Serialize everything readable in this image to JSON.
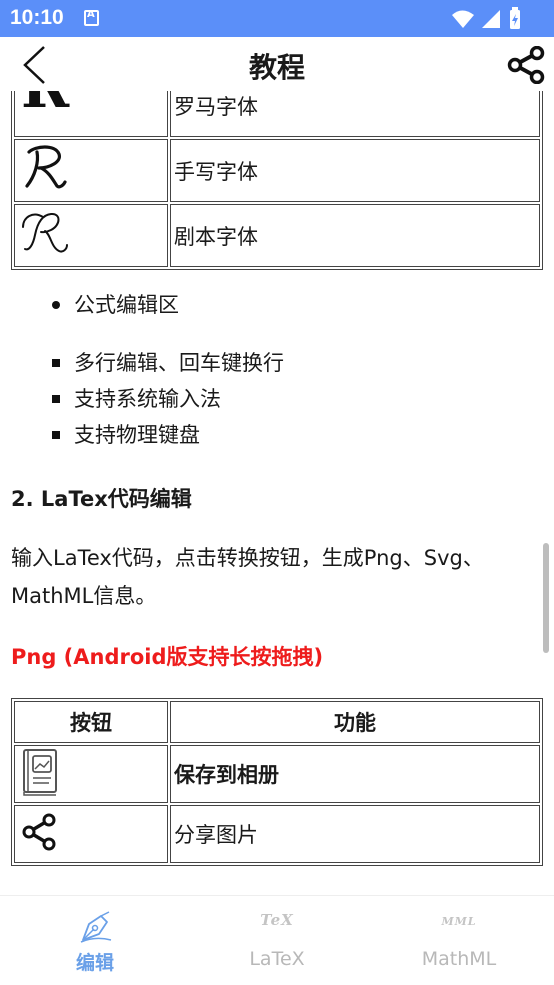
{
  "status_bar": {
    "time": "10:10"
  },
  "header": {
    "title": "教程"
  },
  "font_table": {
    "rows": [
      {
        "label": "罗马字体"
      },
      {
        "label": "手写字体"
      },
      {
        "label": "剧本字体"
      }
    ]
  },
  "bullets_circle": [
    "公式编辑区"
  ],
  "bullets_square": [
    "多行编辑、回车键换行",
    "支持系统输入法",
    "支持物理键盘"
  ],
  "section_heading": "2. LaTex代码编辑",
  "paragraph": "输入LaTex代码，点击转换按钮，生成Png、Svg、MathML信息。",
  "red_heading": "Png (Android版支持长按拖拽)",
  "button_table": {
    "headers": [
      "按钮",
      "功能"
    ],
    "rows": [
      {
        "icon": "photo-album-icon",
        "label": "保存到相册"
      },
      {
        "icon": "share-icon",
        "label": "分享图片"
      }
    ]
  },
  "bottom_nav": {
    "tabs": [
      {
        "label": "编辑",
        "icon_text": "",
        "active": true
      },
      {
        "label": "LaTeX",
        "icon_text": "TeX",
        "active": false
      },
      {
        "label": "MathML",
        "icon_text": "MML",
        "active": false
      }
    ]
  },
  "colors": {
    "status_bar": "#5b8ff9",
    "accent": "#6aa0e8",
    "red_heading": "#ee1c1c",
    "inactive": "#b8b8b8"
  }
}
